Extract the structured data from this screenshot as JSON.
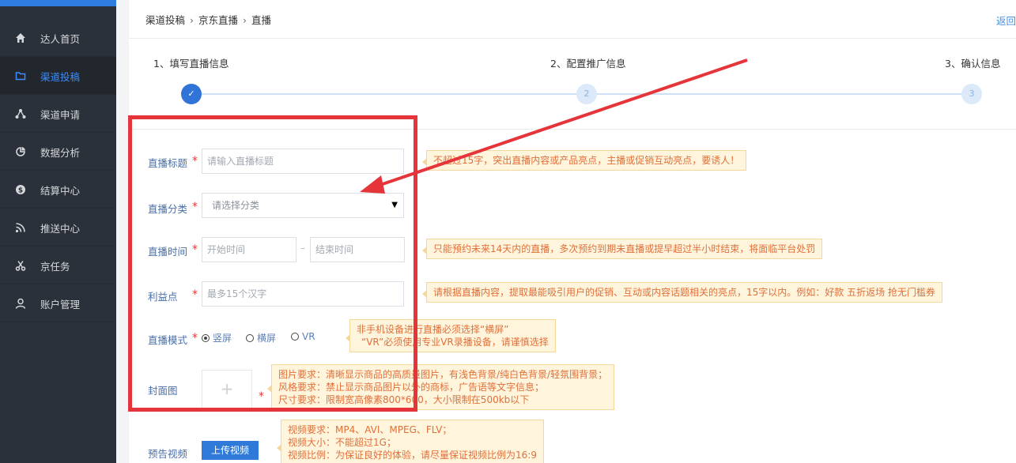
{
  "sidebar": {
    "items": [
      {
        "label": "达人首页",
        "icon": "home-icon",
        "active": false
      },
      {
        "label": "渠道投稿",
        "icon": "folder-icon",
        "active": true
      },
      {
        "label": "渠道申请",
        "icon": "share-nodes-icon",
        "active": false
      },
      {
        "label": "数据分析",
        "icon": "pie-chart-icon",
        "active": false
      },
      {
        "label": "结算中心",
        "icon": "dollar-icon",
        "active": false
      },
      {
        "label": "推送中心",
        "icon": "rss-icon",
        "active": false
      },
      {
        "label": "京任务",
        "icon": "scissors-icon",
        "active": false
      },
      {
        "label": "账户管理",
        "icon": "user-icon",
        "active": false
      }
    ],
    "accent": "#2e7de0",
    "active_color": "#3b8cff"
  },
  "breadcrumb": [
    "渠道投稿",
    "京东直播",
    "直播"
  ],
  "back_label": "返回",
  "steps": [
    {
      "label": "1、填写直播信息",
      "marker": "✓",
      "done": true
    },
    {
      "label": "2、配置推广信息",
      "marker": "2",
      "done": false
    },
    {
      "label": "3、确认信息",
      "marker": "3",
      "done": false
    }
  ],
  "form": {
    "title": {
      "label": "直播标题",
      "placeholder": "请输入直播标题",
      "tip": "不超过15字，突出直播内容或产品亮点，主播或促销互动亮点，要诱人！"
    },
    "category": {
      "label": "直播分类",
      "placeholder": "请选择分类"
    },
    "time": {
      "label": "直播时间",
      "start_placeholder": "开始时间",
      "separator": "–",
      "end_placeholder": "结束时间",
      "tip": "只能预约未来14天内的直播，多次预约到期未直播或提早超过半小时结束，将面临平台处罚"
    },
    "benefit": {
      "label": "利益点",
      "placeholder": "最多15个汉字",
      "tip": "请根据直播内容，提取最能吸引用户的促销、互动或内容话题相关的亮点，15字以内。例如：好款 五折返场 抢无门槛券"
    },
    "mode": {
      "label": "直播模式",
      "options": [
        "竖屏",
        "横屏",
        "VR"
      ],
      "selected": "竖屏",
      "tip_lines": [
        "非手机设备进行直播必须选择“横屏”",
        "“VR”必须使用专业VR录播设备，请谨慎选择"
      ]
    },
    "cover": {
      "label": "封面图",
      "upload_glyph": "+",
      "tip_lines": [
        "图片要求：清晰显示商品的高质量图片，有浅色背景/纯白色背景/轻氛围背景；",
        "风格要求：禁止显示商品图片以外的商标，广告语等文字信息；",
        "尺寸要求：限制宽高像素800*600，大小限制在500kb以下"
      ]
    },
    "video": {
      "label": "预告视频",
      "button": "上传视频",
      "tip_lines": [
        "视频要求：MP4、AVI、MPEG、FLV；",
        "视频大小：不能超过1G；",
        "视频比例：为保证良好的体验，请尽量保证视频比例为16:9"
      ]
    },
    "required_mark": "*"
  },
  "colors": {
    "annotation_red": "#e5353a",
    "tip_bg": "#fff4dc",
    "tip_text": "#e0703a",
    "primary_button": "#2f7ad9"
  }
}
